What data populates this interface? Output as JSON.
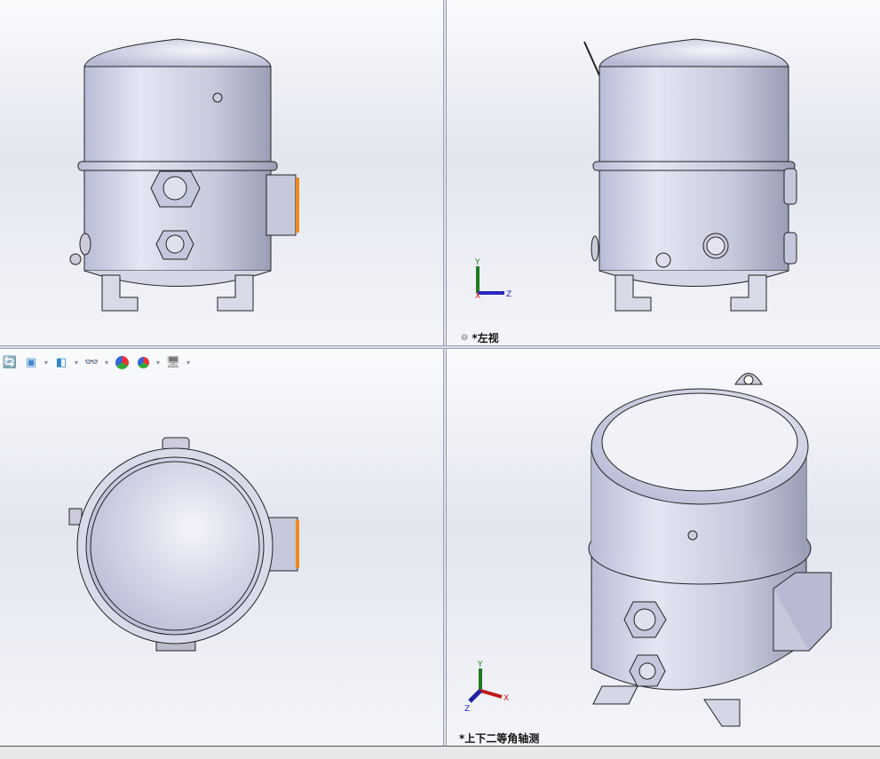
{
  "viewports": {
    "top_right": {
      "label": "*左视"
    },
    "bottom_right": {
      "label": "*上下二等角轴测"
    }
  },
  "toolbar": {
    "icons": [
      "view-orientation-icon",
      "section-view-icon",
      "display-style-icon",
      "hide-show-items-icon",
      "edit-appearance-icon",
      "apply-scene-icon",
      "view-settings-icon"
    ]
  },
  "triad": {
    "x": "X",
    "y": "Y",
    "z": "Z"
  },
  "colors": {
    "axis_x": "#d01010",
    "axis_y": "#1f7a1f",
    "axis_z": "#2020c0",
    "accent_orange": "#f08a1c",
    "divider": "#7b80a6"
  }
}
